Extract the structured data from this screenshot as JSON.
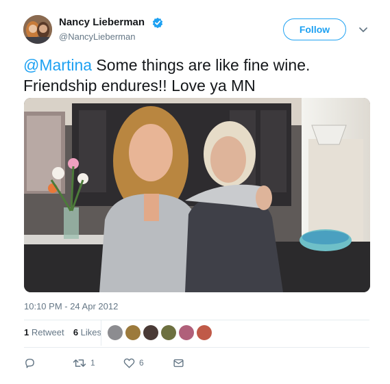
{
  "author": {
    "display_name": "Nancy Lieberman",
    "handle": "@NancyLieberman",
    "avatar": "avatar-photo",
    "verified_icon": "verified-badge-icon"
  },
  "header": {
    "follow_label": "Follow",
    "menu_icon": "chevron-down-icon"
  },
  "tweet": {
    "mention": "@Martina",
    "line1_rest": " Some things are like fine wine.",
    "line2": "Friendship endures!!  Love ya MN",
    "photo": "photo-two-women-in-kitchen"
  },
  "meta": {
    "timestamp": "10:10 PM - 24 Apr 2012"
  },
  "stats": {
    "retweets_count": "1",
    "retweets_label": "Retweet",
    "likes_count": "6",
    "likes_label": "Likes"
  },
  "actions": {
    "reply_icon": "reply-icon",
    "retweet_icon": "retweet-icon",
    "retweet_count": "1",
    "like_icon": "heart-icon",
    "like_count": "6",
    "dm_icon": "envelope-icon"
  },
  "colors": {
    "accent": "#1da1f2",
    "secondary_text": "#657786",
    "divider": "#e6ecf0"
  }
}
